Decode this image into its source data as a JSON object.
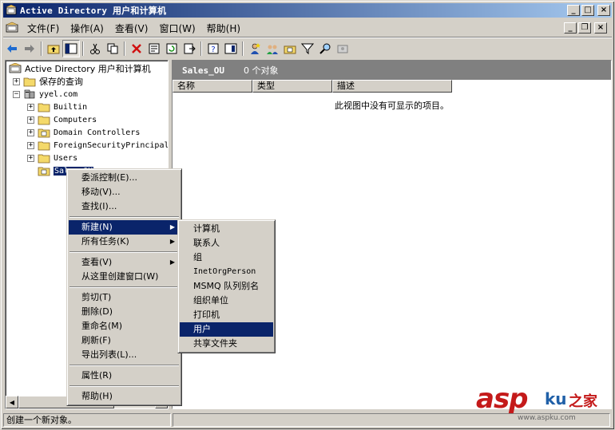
{
  "window": {
    "title": "Active Directory 用户和计算机",
    "buttons": {
      "minimize": "_",
      "maximize": "□",
      "close": "×"
    }
  },
  "menubar": {
    "items": [
      "文件(F)",
      "操作(A)",
      "查看(V)",
      "窗口(W)",
      "帮助(H)"
    ]
  },
  "mdi_buttons": {
    "minimize": "_",
    "restore": "❐",
    "close": "×"
  },
  "toolbar": {
    "icons": [
      "back-icon",
      "forward-icon",
      "up-folder-icon",
      "show-tree-icon",
      "cut-icon",
      "copy-icon",
      "delete-icon",
      "properties-icon",
      "refresh-icon",
      "export-icon",
      "help-icon",
      "console-tree-icon",
      "new-user-icon",
      "new-group-icon",
      "new-ou-icon",
      "filter-icon",
      "find-icon",
      "add-to-group-icon"
    ]
  },
  "tree": {
    "root": "Active Directory 用户和计算机",
    "saved_queries": "保存的查询",
    "domain": "yyel.com",
    "children": [
      "Builtin",
      "Computers",
      "Domain Controllers",
      "ForeignSecurityPrincipal",
      "Users"
    ],
    "selected": "Sales_OU"
  },
  "result": {
    "ou_name": "Sales_OU",
    "object_count": "0 个对象",
    "columns": [
      "名称",
      "类型",
      "描述"
    ],
    "empty_message": "此视图中没有可显示的项目。"
  },
  "context_menu": {
    "group1": [
      "委派控制(E)...",
      "移动(V)...",
      "查找(I)..."
    ],
    "group2": [
      {
        "label": "新建(N)",
        "submenu": true,
        "highlight": true
      },
      {
        "label": "所有任务(K)",
        "submenu": true
      }
    ],
    "group3": [
      {
        "label": "查看(V)",
        "submenu": true
      },
      {
        "label": "从这里创建窗口(W)",
        "submenu": false
      }
    ],
    "group4": [
      "剪切(T)",
      "删除(D)",
      "重命名(M)",
      "刷新(F)",
      "导出列表(L)..."
    ],
    "group5": [
      "属性(R)"
    ],
    "group6": [
      "帮助(H)"
    ]
  },
  "new_submenu": {
    "items": [
      "计算机",
      "联系人",
      "组",
      "InetOrgPerson",
      "MSMQ 队列别名",
      "组织单位",
      "打印机",
      "用户",
      "共享文件夹"
    ],
    "highlighted": "用户"
  },
  "statusbar": {
    "text": "创建一个新对象。"
  },
  "watermark": {
    "asp": "asp",
    "ku": "ku",
    "zhijia": "之家",
    "url": "www.aspku.com"
  }
}
